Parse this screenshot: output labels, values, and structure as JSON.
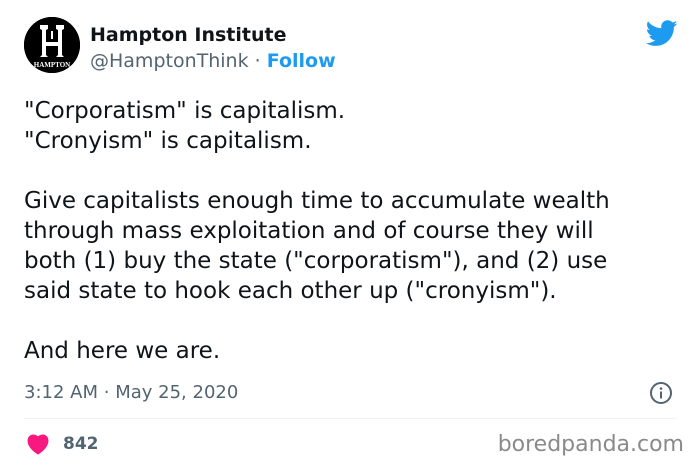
{
  "author": {
    "display_name": "Hampton Institute",
    "handle": "@HamptonThink",
    "separator": "·",
    "follow_label": "Follow",
    "avatar_text": "HAMPTON",
    "avatar_icon": "hampton-institute-logo"
  },
  "tweet": {
    "paragraphs": [
      "\"Corporatism\" is capitalism.\n\"Cronyism\" is capitalism.",
      "Give capitalists enough time to accumulate wealth\nthrough mass exploitation and of course they will\nboth (1) buy the state (\"corporatism\"), and (2) use\nsaid state to hook each other up (\"cronyism\").",
      "And here we are."
    ],
    "time": "3:12 AM",
    "date_separator": "·",
    "date": "May 25, 2020"
  },
  "engagement": {
    "like_count": "842",
    "like_icon": "heart-icon"
  },
  "icons": {
    "twitter": "twitter-bird-icon",
    "info": "info-icon"
  },
  "watermark": "boredpanda.com",
  "colors": {
    "twitter_blue": "#1d9bf0",
    "like_pink": "#f91880",
    "text_primary": "#0f1419",
    "text_secondary": "#536471",
    "watermark": "#8a8a8a"
  }
}
